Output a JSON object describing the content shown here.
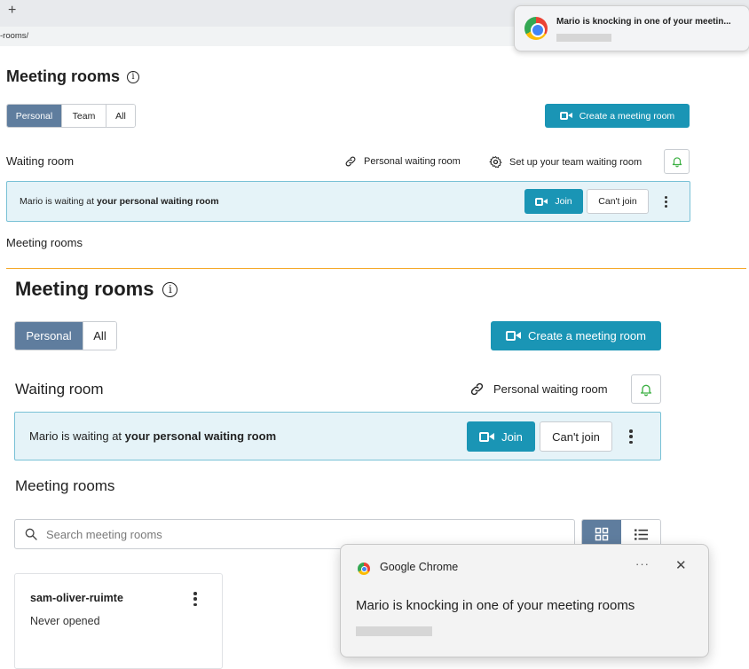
{
  "browser": {
    "new_tab": "+",
    "url_fragment": "-rooms/"
  },
  "notification_mini": {
    "title": "Mario is knocking in one of your meetin..."
  },
  "top_view": {
    "page_title": "Meeting rooms",
    "tabs": [
      "Personal",
      "Team",
      "All"
    ],
    "active_tab": "Personal",
    "create_button": "Create a meeting room",
    "waiting_room_heading": "Waiting room",
    "personal_waiting_room_link": "Personal waiting room",
    "team_waiting_room_link": "Set up your team waiting room",
    "banner": {
      "prefix": "Mario is waiting at ",
      "emphasis": "your personal waiting room"
    },
    "join_button": "Join",
    "cant_join_button": "Can't join",
    "meeting_rooms_heading": "Meeting rooms"
  },
  "main_view": {
    "page_title": "Meeting rooms",
    "tabs": [
      "Personal",
      "All"
    ],
    "active_tab": "Personal",
    "create_button": "Create a meeting room",
    "waiting_room_heading": "Waiting room",
    "personal_waiting_room_link": "Personal waiting room",
    "banner": {
      "prefix": "Mario is waiting at ",
      "emphasis": "your personal waiting room"
    },
    "join_button": "Join",
    "cant_join_button": "Can't join",
    "meeting_rooms_heading": "Meeting rooms",
    "search_placeholder": "Search meeting rooms",
    "view_mode": "grid",
    "rooms": [
      {
        "name": "sam-oliver-ruimte",
        "status": "Never opened"
      }
    ]
  },
  "notification": {
    "app_name": "Google Chrome",
    "more": "···",
    "close": "✕",
    "message": "Mario is knocking in one of your meeting rooms"
  },
  "colors": {
    "accent": "#1a95b5",
    "segment_active": "#5f7d9e",
    "banner_bg": "#e5f3f8",
    "banner_border": "#79c1d6",
    "divider": "#f5a623",
    "bell": "#3cb043"
  }
}
